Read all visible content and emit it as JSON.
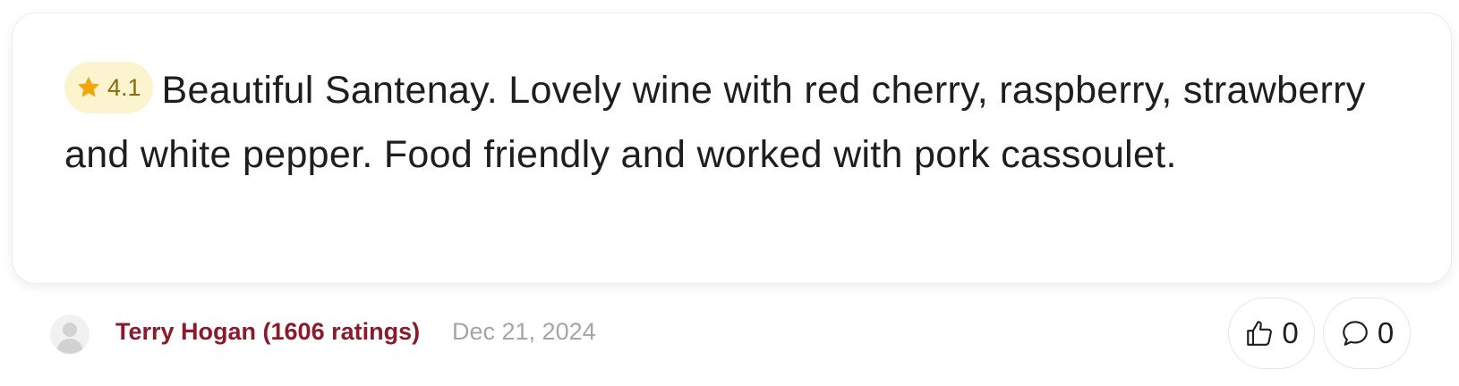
{
  "review": {
    "rating": "4.1",
    "text": "Beautiful Santenay. Lovely wine with red cherry, raspberry, strawberry and white pepper. Food friendly and worked with pork cassoulet."
  },
  "author": {
    "name": "Terry Hogan (1606 ratings)",
    "date": "Dec 21, 2024"
  },
  "actions": {
    "likes": "0",
    "comments": "0"
  },
  "icons": {
    "rating": "star-icon",
    "avatar": "user-avatar-icon",
    "like": "thumbs-up-icon",
    "comment": "speech-bubble-icon"
  },
  "colors": {
    "star": "#f2a60c",
    "rating_pill_bg": "#fbf4cf",
    "rating_text": "#8a6a0c",
    "author_link": "#8b1a2b",
    "date_text": "#a5a5a5"
  }
}
